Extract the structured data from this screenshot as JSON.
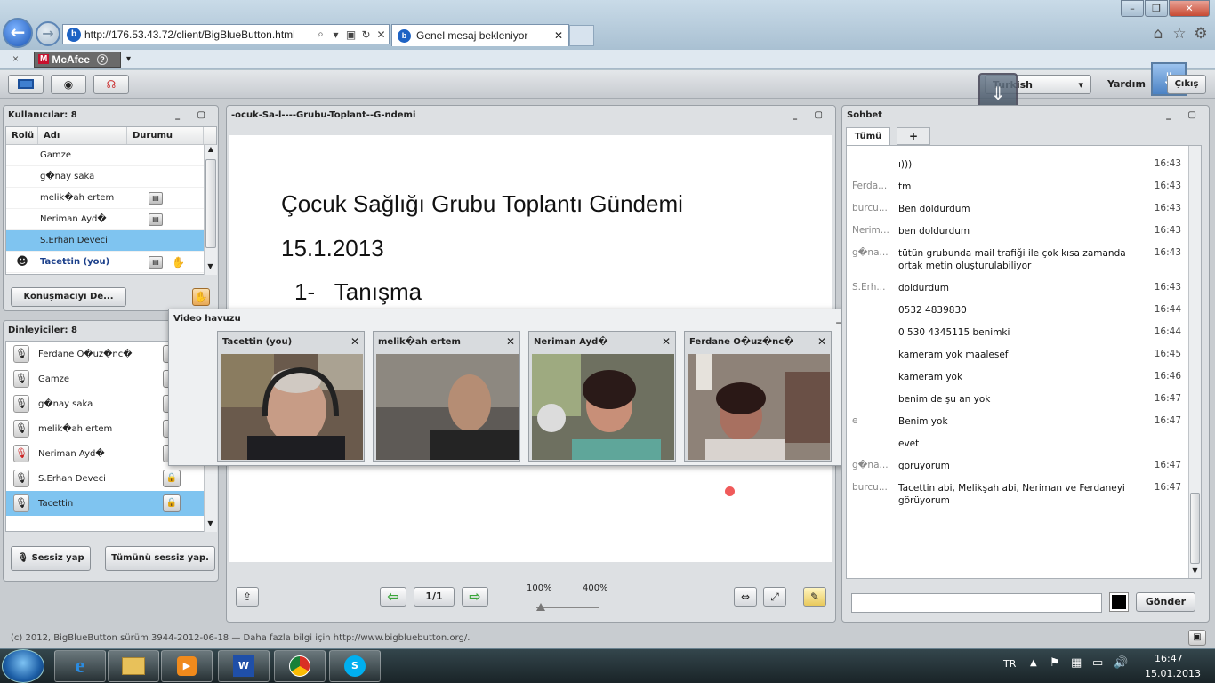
{
  "browser": {
    "url": "http://176.53.43.72/client/BigBlueButton.html",
    "tab_title": "Genel mesaj bekleniyor",
    "toolbar_close": "×",
    "mcafee_label": "McAfee",
    "mcafee_help": "?",
    "icons": [
      "back-icon",
      "forward-icon",
      "search-icon",
      "refresh-icon",
      "stop-icon",
      "home-icon",
      "favorites-icon",
      "tools-icon"
    ]
  },
  "app_header": {
    "language": "Turkish",
    "help_label": "Yardım",
    "logout_label": "Çıkış"
  },
  "users_panel": {
    "title": "Kullanıcılar: 8",
    "columns": [
      "Rolü",
      "Adı",
      "Durumu"
    ],
    "rows": [
      {
        "name": "Gamze",
        "selected": false,
        "bold": false
      },
      {
        "name": "g�nay saka",
        "selected": false,
        "bold": false
      },
      {
        "name": "melik�ah ertem",
        "selected": false,
        "bold": false
      },
      {
        "name": "Neriman Ayd�",
        "selected": false,
        "bold": false
      },
      {
        "name": "S.Erhan Deveci",
        "selected": true,
        "bold": false
      },
      {
        "name": "Tacettin (you)",
        "selected": false,
        "bold": true
      }
    ],
    "presenter_button": "Konuşmacıyı De..."
  },
  "listeners_panel": {
    "title": "Dinleyiciler: 8",
    "rows": [
      {
        "name": "Ferdane O�uz�nc�",
        "muted": false,
        "selected": false
      },
      {
        "name": "Gamze",
        "muted": false,
        "selected": false
      },
      {
        "name": "g�nay saka",
        "muted": false,
        "selected": false
      },
      {
        "name": "melik�ah ertem",
        "muted": false,
        "selected": false
      },
      {
        "name": "Neriman Ayd�",
        "muted": true,
        "selected": false
      },
      {
        "name": "S.Erhan Deveci",
        "muted": false,
        "selected": false
      },
      {
        "name": "Tacettin",
        "muted": false,
        "selected": true
      }
    ],
    "mute_button": "Sessiz yap",
    "mute_all_button": "Tümünü sessiz yap."
  },
  "presentation": {
    "title": "-ocuk-Sa-l----Grubu-Toplant--G-ndemi",
    "slide_title": "Çocuk Sağlığı Grubu Toplantı Gündemi",
    "slide_date": "15.1.2013",
    "slide_item_num": "1-",
    "slide_item": "Tanışma",
    "page": "1/1",
    "zoom_min": "100%",
    "zoom_max": "400%"
  },
  "video_dock": {
    "title": "Video havuzu",
    "windows": [
      {
        "name": "Tacettin (you)"
      },
      {
        "name": "melik�ah ertem"
      },
      {
        "name": "Neriman Ayd�"
      },
      {
        "name": "Ferdane O�uz�nc�"
      }
    ]
  },
  "chat": {
    "title": "Sohbet",
    "tab_all": "Tümü",
    "tab_add": "+",
    "send_button": "Gönder",
    "messages": [
      {
        "who": "",
        "msg": "ı)))",
        "time": "16:43"
      },
      {
        "who": "Ferda...",
        "msg": "tm",
        "time": "16:43"
      },
      {
        "who": "burcu...",
        "msg": "Ben doldurdum",
        "time": "16:43"
      },
      {
        "who": "Nerim...",
        "msg": "ben doldurdum",
        "time": "16:43"
      },
      {
        "who": "g�na...",
        "msg": "tütün grubunda mail trafiği ile çok kısa zamanda ortak metin oluşturulabiliyor",
        "time": "16:43"
      },
      {
        "who": "S.Erh...",
        "msg": "doldurdum",
        "time": "16:43"
      },
      {
        "who": "",
        "msg": "0532 4839830",
        "time": "16:44"
      },
      {
        "who": "",
        "msg": "0 530 4345115 benimki",
        "time": "16:44"
      },
      {
        "who": "",
        "msg": "kameram yok maalesef",
        "time": "16:45"
      },
      {
        "who": "",
        "msg": "kameram yok",
        "time": "16:46"
      },
      {
        "who": "",
        "msg": "benim de şu an yok",
        "time": "16:47"
      },
      {
        "who": "e",
        "msg": "Benim yok",
        "time": "16:47"
      },
      {
        "who": "",
        "msg": "evet",
        "time": ""
      },
      {
        "who": "g�na...",
        "msg": "görüyorum",
        "time": "16:47"
      },
      {
        "who": "burcu...",
        "msg": "Tacettin abi, Melikşah abi, Neriman ve Ferdaneyi görüyorum",
        "time": "16:47"
      }
    ]
  },
  "footer": "(c) 2012, BigBlueButton sürüm 3944-2012-06-18 — Daha fazla bilgi için http://www.bigbluebutton.org/.",
  "taskbar": {
    "lang": "TR",
    "time": "16:47",
    "date": "15.01.2013"
  }
}
